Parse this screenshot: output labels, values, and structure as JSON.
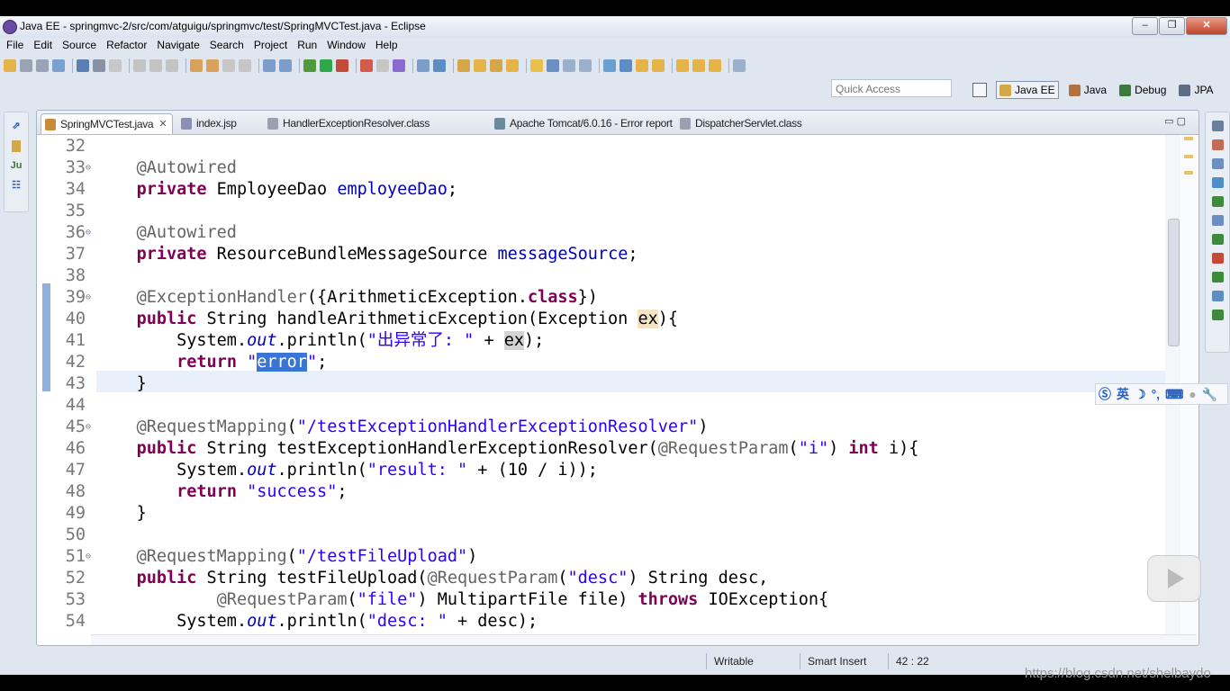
{
  "window": {
    "title": "Java EE - springmvc-2/src/com/atguigu/springmvc/test/SpringMVCTest.java - Eclipse"
  },
  "menu": [
    "File",
    "Edit",
    "Source",
    "Refactor",
    "Navigate",
    "Search",
    "Project",
    "Run",
    "Window",
    "Help"
  ],
  "quick_access": {
    "placeholder": "Quick Access"
  },
  "perspectives": [
    {
      "label": "Java EE",
      "active": true,
      "icon": "java-ee-icon"
    },
    {
      "label": "Java",
      "active": false,
      "icon": "java-icon"
    },
    {
      "label": "Debug",
      "active": false,
      "icon": "debug-icon"
    },
    {
      "label": "JPA",
      "active": false,
      "icon": "jpa-icon"
    }
  ],
  "tabs": [
    {
      "label": "SpringMVCTest.java",
      "active": true,
      "icon": "java-file-icon"
    },
    {
      "label": "index.jsp",
      "active": false,
      "icon": "jsp-file-icon"
    },
    {
      "label": "HandlerExceptionResolver.class",
      "active": false,
      "icon": "class-file-icon"
    },
    {
      "label": "Apache Tomcat/6.0.16 - Error report",
      "active": false,
      "icon": "globe-icon"
    },
    {
      "label": "DispatcherServlet.class",
      "active": false,
      "icon": "class-file-icon"
    }
  ],
  "code": {
    "lines": [
      {
        "n": "32",
        "t": []
      },
      {
        "n": "33",
        "fold": true,
        "t": [
          [
            "ann",
            "@Autowired"
          ]
        ]
      },
      {
        "n": "34",
        "t": [
          [
            "kw",
            "private"
          ],
          [
            "",
            ""
          ],
          [
            "",
            " EmployeeDao "
          ],
          [
            "fld",
            "employeeDao"
          ],
          [
            "",
            ";"
          ]
        ]
      },
      {
        "n": "35",
        "t": []
      },
      {
        "n": "36",
        "fold": true,
        "t": [
          [
            "ann",
            "@Autowired"
          ]
        ]
      },
      {
        "n": "37",
        "t": [
          [
            "kw",
            "private"
          ],
          [
            "",
            " ResourceBundleMessageSource "
          ],
          [
            "fld",
            "messageSource"
          ],
          [
            "",
            ";"
          ]
        ]
      },
      {
        "n": "38",
        "t": []
      },
      {
        "n": "39",
        "fold": true,
        "t": [
          [
            "ann",
            "@ExceptionHandler"
          ],
          [
            "",
            "({ArithmeticException."
          ],
          [
            "kw",
            "class"
          ],
          [
            "",
            "})"
          ]
        ]
      },
      {
        "n": "40",
        "t": [
          [
            "kw",
            "public"
          ],
          [
            "",
            " String handleArithmeticException(Exception "
          ],
          [
            "occ",
            "ex"
          ],
          [
            "",
            "){"
          ]
        ]
      },
      {
        "n": "41",
        "t": [
          [
            "",
            "    System."
          ],
          [
            "it",
            "out"
          ],
          [
            "",
            ".println("
          ],
          [
            "str",
            "\"出异常了: \""
          ],
          [
            "",
            " + "
          ],
          [
            "occ2",
            "ex"
          ],
          [
            "",
            ");"
          ]
        ]
      },
      {
        "n": "42",
        "t": [
          [
            "",
            "    "
          ],
          [
            "kw",
            "return"
          ],
          [
            "",
            " "
          ],
          [
            "str",
            "\""
          ],
          [
            "sel",
            "error"
          ],
          [
            "str",
            "\""
          ],
          [
            "",
            ";"
          ]
        ]
      },
      {
        "n": "43",
        "t": [
          [
            "",
            "}"
          ]
        ]
      },
      {
        "n": "44",
        "t": []
      },
      {
        "n": "45",
        "fold": true,
        "t": [
          [
            "ann",
            "@RequestMapping"
          ],
          [
            "",
            "("
          ],
          [
            "str",
            "\"/testExceptionHandlerExceptionResolver\""
          ],
          [
            "",
            ")"
          ]
        ]
      },
      {
        "n": "46",
        "t": [
          [
            "kw",
            "public"
          ],
          [
            "",
            " String testExceptionHandlerExceptionResolver("
          ],
          [
            "ann",
            "@RequestParam"
          ],
          [
            "",
            "("
          ],
          [
            "str",
            "\"i\""
          ],
          [
            "",
            ") "
          ],
          [
            "kw",
            "int"
          ],
          [
            "",
            " i){"
          ]
        ]
      },
      {
        "n": "47",
        "t": [
          [
            "",
            "    System."
          ],
          [
            "it",
            "out"
          ],
          [
            "",
            ".println("
          ],
          [
            "str",
            "\"result: \""
          ],
          [
            "",
            " + (10 / i));"
          ]
        ]
      },
      {
        "n": "48",
        "t": [
          [
            "",
            "    "
          ],
          [
            "kw",
            "return"
          ],
          [
            "",
            " "
          ],
          [
            "str",
            "\"success\""
          ],
          [
            "",
            ";"
          ]
        ]
      },
      {
        "n": "49",
        "t": [
          [
            "",
            "}"
          ]
        ]
      },
      {
        "n": "50",
        "t": []
      },
      {
        "n": "51",
        "fold": true,
        "t": [
          [
            "ann",
            "@RequestMapping"
          ],
          [
            "",
            "("
          ],
          [
            "str",
            "\"/testFileUpload\""
          ],
          [
            "",
            ")"
          ]
        ]
      },
      {
        "n": "52",
        "t": [
          [
            "kw",
            "public"
          ],
          [
            "",
            " String testFileUpload("
          ],
          [
            "ann",
            "@RequestParam"
          ],
          [
            "",
            "("
          ],
          [
            "str",
            "\"desc\""
          ],
          [
            "",
            ") String desc,"
          ]
        ]
      },
      {
        "n": "53",
        "t": [
          [
            "",
            "        "
          ],
          [
            "ann",
            "@RequestParam"
          ],
          [
            "",
            "("
          ],
          [
            "str",
            "\"file\""
          ],
          [
            "",
            ") MultipartFile file) "
          ],
          [
            "kw",
            "throws"
          ],
          [
            "",
            " IOException{"
          ]
        ]
      },
      {
        "n": "54",
        "t": [
          [
            "",
            "    System."
          ],
          [
            "it",
            "out"
          ],
          [
            "",
            ".println("
          ],
          [
            "str",
            "\"desc: \""
          ],
          [
            "",
            " + desc);"
          ]
        ]
      }
    ]
  },
  "status": {
    "writable": "Writable",
    "insert_mode": "Smart Insert",
    "position": "42 : 22"
  },
  "ime": {
    "lang": "英"
  },
  "watermark": "https://blog.csdn.net/shelbaydo"
}
